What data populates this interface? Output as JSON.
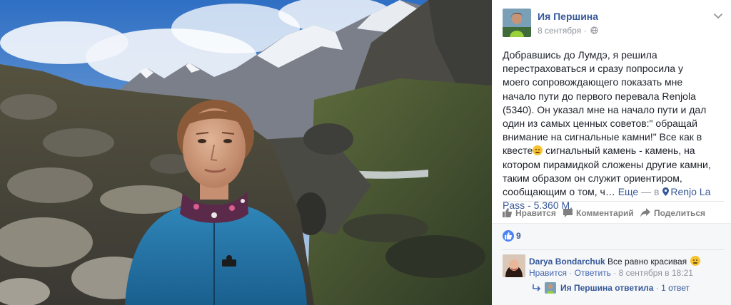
{
  "post": {
    "author": "Ия Першина",
    "date": "8 сентября",
    "date_separator": "·",
    "text_main": "Добравшись до Лумдэ, я решила перестраховаться и сразу попросила у моего сопровождающего показать мне начало пути до первого перевала Renjola (5340). Он указал мне на начало пути и дал один из самых ценных советов:\" обращай внимание на сигнальные камни!\" Все как в квесте",
    "text_after_emoji": " сигнальный камень - камень, на котором пирамидкой сложены другие камни, таким образом он служит ориентиром, сообщающим о том, ч…",
    "more_label": "Еще",
    "location_prefix": " — в ",
    "location": "Renjo La Pass - 5.360 M.",
    "image_alt": "Девушка в синей флисовой куртке на фоне гор"
  },
  "actions": {
    "like": "Нравится",
    "comment": "Комментарий",
    "share": "Поделиться"
  },
  "reactions": {
    "count": "9"
  },
  "comment": {
    "author": "Darya Bondarchuk",
    "text": "Все равно красивая",
    "like_link": "Нравится",
    "reply_link": "Ответить",
    "separator": "·",
    "timestamp": "8 сентября в 18:21"
  },
  "reply": {
    "text": "Ия Першина ответила",
    "separator": "·",
    "count": "1 ответ"
  },
  "icons": {
    "menu": "chevron-down-icon",
    "privacy": "globe-icon",
    "location": "pin-icon",
    "like": "thumbs-up-icon",
    "comment": "speech-bubble-icon",
    "share": "share-arrow-icon",
    "reaction": "like-badge-icon",
    "reply": "reply-arrow-icon"
  },
  "colors": {
    "link": "#365899",
    "meta": "#90949c",
    "reaction_blue": "#4d83f6",
    "feedback_bg": "#f6f7f9"
  }
}
